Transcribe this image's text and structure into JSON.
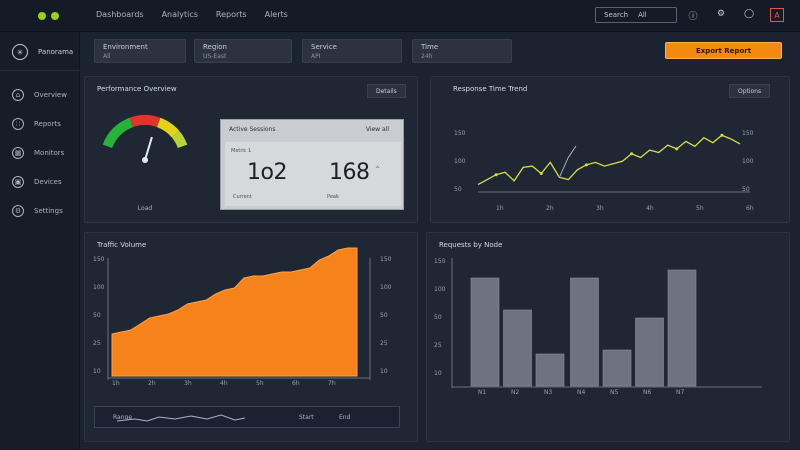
{
  "topbar": {
    "nav": [
      "Dashboards",
      "Analytics",
      "Reports",
      "Alerts"
    ],
    "search_value": "Search",
    "search_filter": "All",
    "icons": [
      "help-icon",
      "settings-icon",
      "bell-icon"
    ],
    "avatar_initial": "A"
  },
  "sidebar": {
    "brand": "Panorama",
    "items": [
      {
        "label": "Overview",
        "icon": "home-icon"
      },
      {
        "label": "Reports",
        "icon": "chart-icon"
      },
      {
        "label": "Monitors",
        "icon": "monitor-icon"
      },
      {
        "label": "Devices",
        "icon": "device-icon"
      },
      {
        "label": "Settings",
        "icon": "settings-icon"
      }
    ]
  },
  "filters": [
    {
      "label": "Environment",
      "sub": "All"
    },
    {
      "label": "Region",
      "sub": "US-East"
    },
    {
      "label": "Service",
      "sub": "API"
    },
    {
      "label": "Time",
      "sub": "24h"
    }
  ],
  "export_label": "Export Report",
  "performance_panel": {
    "title": "Performance Overview",
    "button": "Details",
    "gauge_label": "Load",
    "gauge_value": 0.62,
    "gauge_colors": [
      "#27b23a",
      "#e3342a",
      "#e2d21a",
      "#b8d43a"
    ],
    "kpi": {
      "title": "Active Sessions",
      "button": "View all",
      "caption": "Metric 1",
      "value_1": "1o2",
      "foot_1": "Current",
      "value_2": "168",
      "foot_2": "Peak",
      "mark": "^"
    }
  },
  "trend_panel": {
    "title": "Response Time Trend",
    "button": "Options",
    "left_ticks": [
      "150",
      "100",
      "50"
    ],
    "right_ticks": [
      "150",
      "100",
      "50"
    ],
    "x_ticks": [
      "1h",
      "2h",
      "3h",
      "4h",
      "5h",
      "6h"
    ]
  },
  "traffic_panel": {
    "title": "Traffic Volume",
    "y_ticks": [
      "150",
      "100",
      "50",
      "25",
      "10"
    ],
    "right_ticks": [
      "150",
      "100",
      "50",
      "25",
      "10"
    ],
    "x_ticks": [
      "1h",
      "2h",
      "3h",
      "4h",
      "5h",
      "6h",
      "7h"
    ],
    "range_labels": [
      "Range",
      "Start",
      "End"
    ]
  },
  "bar_panel": {
    "title": "Requests by Node",
    "y_ticks": [
      "150",
      "100",
      "50",
      "25",
      "10"
    ],
    "x_ticks": [
      "N1",
      "N2",
      "N3",
      "N4",
      "N5",
      "N6",
      "N7"
    ]
  },
  "chart_data": [
    {
      "type": "line",
      "x": [
        1,
        2,
        3,
        4,
        5,
        6,
        7,
        8,
        9,
        10,
        11,
        12,
        13,
        14,
        15,
        16,
        17,
        18,
        19,
        20,
        21,
        22,
        23,
        24,
        25,
        26,
        27,
        28,
        29,
        30
      ],
      "values": [
        42,
        50,
        58,
        62,
        48,
        70,
        72,
        60,
        78,
        54,
        50,
        66,
        74,
        78,
        72,
        76,
        80,
        92,
        86,
        98,
        94,
        106,
        100,
        112,
        104,
        118,
        110,
        122,
        116,
        108
      ],
      "ylim": [
        30,
        150
      ],
      "color": "#d7dc4a"
    },
    {
      "type": "area",
      "x": [
        1,
        2,
        3,
        4,
        5,
        6,
        7,
        8,
        9,
        10,
        11,
        12,
        13,
        14,
        15,
        16,
        17,
        18,
        19,
        20,
        21,
        22,
        23,
        24,
        25,
        26,
        27
      ],
      "values": [
        42,
        44,
        46,
        52,
        58,
        60,
        62,
        66,
        72,
        74,
        76,
        82,
        86,
        88,
        98,
        100,
        100,
        102,
        104,
        104,
        106,
        108,
        116,
        120,
        126,
        128,
        128
      ],
      "ylim": [
        0,
        140
      ],
      "color": "#f5821a"
    },
    {
      "type": "bar",
      "categories": [
        "N1",
        "N2",
        "N3",
        "N4",
        "N5",
        "N6",
        "N7"
      ],
      "values": [
        108,
        76,
        32,
        108,
        36,
        68,
        116
      ],
      "ylim": [
        0,
        140
      ],
      "color": "#6b7480"
    }
  ]
}
